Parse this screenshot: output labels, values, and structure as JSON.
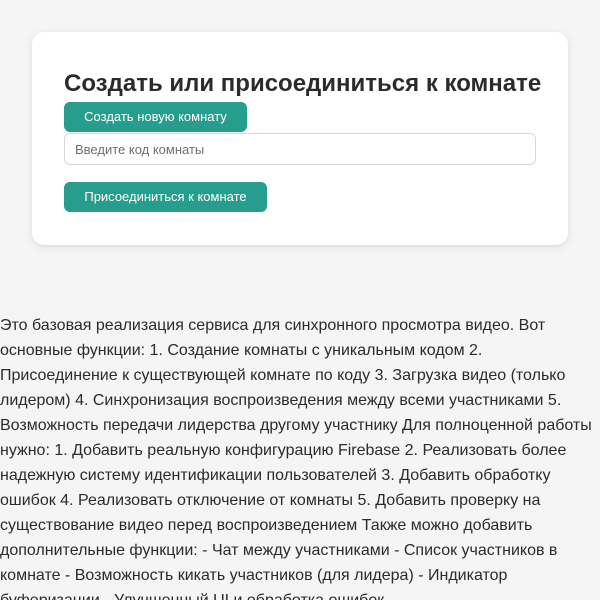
{
  "room_panel": {
    "title": "Создать или присоединиться к комнате",
    "create_button_label": "Создать новую комнату",
    "room_code_input": {
      "value": "",
      "placeholder": "Введите код комнаты"
    },
    "join_button_label": "Присоединиться к комнате"
  },
  "description": {
    "text": "Это базовая реализация сервиса для синхронного просмотра видео. Вот основные функции: 1. Создание комнаты с уникальным кодом 2. Присоединение к существующей комнате по коду 3. Загрузка видео (только лидером) 4. Синхронизация воспроизведения между всеми участниками 5. Возможность передачи лидерства другому участнику Для полноценной работы нужно: 1. Добавить реальную конфигурацию Firebase 2. Реализовать более надежную систему идентификации пользователей 3. Добавить обработку ошибок 4. Реализовать отключение от комнаты 5. Добавить проверку на существование видео перед воспроизведением Также можно добавить дополнительные функции: - Чат между участниками - Список участников в комнате - Возможность кикать участников (для лидера) - Индикатор буферизации - Улучшенный UI и обработка ошибок"
  },
  "colors": {
    "page_background": "#f5f5f5",
    "card_background": "#ffffff",
    "accent": "#279e8d",
    "text": "#2b2b2b"
  }
}
